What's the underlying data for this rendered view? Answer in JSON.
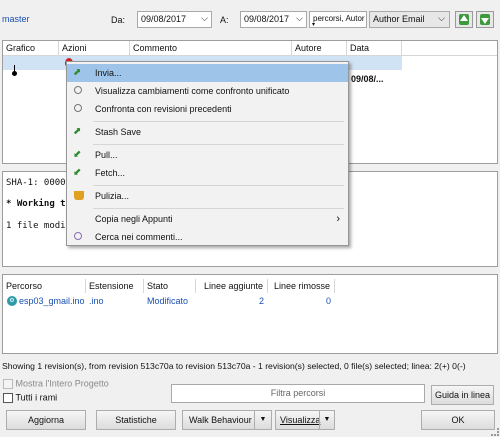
{
  "toolbar": {
    "branch": "master",
    "from_label": "Da:",
    "from_date": "09/08/2017",
    "to_label": "A:",
    "to_date": "09/08/2017",
    "search_value": "percorsi, Autor",
    "filter_select": "Author Email",
    "colors": {
      "green": "#3c9a3c"
    }
  },
  "log_grid": {
    "headers": [
      "Grafico",
      "Azioni",
      "Commento",
      "Autore",
      "Data"
    ],
    "row_date": "09/08/..."
  },
  "context_menu": {
    "items": [
      {
        "label": "Invia...",
        "icon": "push-arrow-icon"
      },
      {
        "label": "Visualizza cambiamenti come confronto unificato",
        "icon": "magnifier-icon"
      },
      {
        "label": "Confronta con revisioni precedenti",
        "icon": "magnifier-icon"
      },
      {
        "label": "Stash Save",
        "icon": "stash-arrow-icon"
      },
      {
        "label": "Pull...",
        "icon": "pull-arrow-icon"
      },
      {
        "label": "Fetch...",
        "icon": "fetch-arrow-icon"
      },
      {
        "label": "Pulizia...",
        "icon": "broom-icon"
      },
      {
        "label": "Copia negli Appunti",
        "icon": "",
        "submenu": "›"
      },
      {
        "label": "Cerca nei commenti...",
        "icon": "search-icon"
      }
    ]
  },
  "details": {
    "sha_line": "SHA-1: 00000",
    "working_line": "* Working t",
    "files_line": "1 file modi"
  },
  "files_grid": {
    "headers": [
      "Percorso",
      "Estensione",
      "Stato",
      "Linee aggiunte",
      "Linee rimosse"
    ],
    "rows": [
      {
        "path": "esp03_gmail.ino",
        "ext": ".ino",
        "state": "Modificato",
        "added": "2",
        "removed": "0"
      }
    ]
  },
  "status_text": "Showing 1 revision(s), from revision 513c70a to revision 513c70a - 1 revision(s) selected, 0 file(s) selected; linea: 2(+) 0(-)",
  "bottom": {
    "show_whole_project": "Mostra l'Intero Progetto",
    "all_branches": "Tutti i rami",
    "filter_placeholder": "Filtra percorsi",
    "help_button": "Guida in linea",
    "refresh_button": "Aggiorna",
    "stats_button": "Statistiche",
    "walk_button": "Walk Behaviour",
    "view_button": "Visualizza",
    "ok_button": "OK"
  }
}
